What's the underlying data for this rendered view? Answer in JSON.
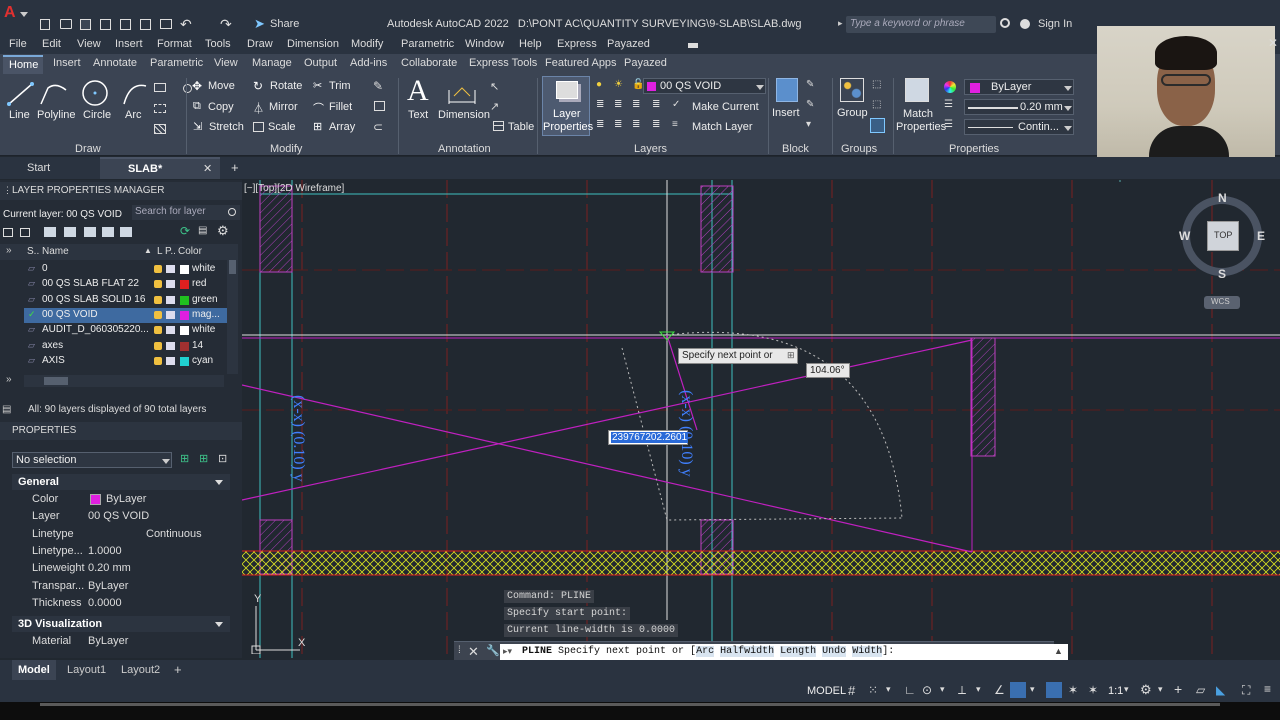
{
  "title": {
    "app": "Autodesk AutoCAD 2022",
    "path": "D:\\PONT AC\\QUANTITY SURVEYING\\9-SLAB\\SLAB.dwg",
    "share": "Share",
    "search_placeholder": "Type a keyword or phrase",
    "sign_in": "Sign In"
  },
  "menu": [
    "File",
    "Edit",
    "View",
    "Insert",
    "Format",
    "Tools",
    "Draw",
    "Dimension",
    "Modify",
    "Parametric",
    "Window",
    "Help",
    "Express",
    "Payazed"
  ],
  "ribbon_tabs": [
    "Home",
    "Insert",
    "Annotate",
    "Parametric",
    "View",
    "Manage",
    "Output",
    "Add-ins",
    "Collaborate",
    "Express Tools",
    "Featured Apps",
    "Payazed"
  ],
  "ribbon": {
    "draw": {
      "line": "Line",
      "polyline": "Polyline",
      "circle": "Circle",
      "arc": "Arc",
      "panel": "Draw"
    },
    "modify": {
      "move": "Move",
      "rotate": "Rotate",
      "trim": "Trim",
      "copy": "Copy",
      "mirror": "Mirror",
      "fillet": "Fillet",
      "stretch": "Stretch",
      "scale": "Scale",
      "array": "Array",
      "panel": "Modify"
    },
    "annotation": {
      "text": "Text",
      "dimension": "Dimension",
      "table": "Table",
      "panel": "Annotation"
    },
    "layers": {
      "layer_properties": "Layer Properties",
      "current": "00 QS VOID",
      "make_current": "Make Current",
      "match_layer": "Match Layer",
      "panel": "Layers"
    },
    "block": {
      "insert": "Insert",
      "panel": "Block"
    },
    "groups": {
      "group": "Group",
      "panel": "Groups"
    },
    "properties": {
      "match_properties": "Match Properties",
      "color": "ByLayer",
      "lineweight": "0.20 mm",
      "linetype": "Contin...",
      "panel": "Properties"
    }
  },
  "doc_tabs": {
    "start": "Start",
    "active": "SLAB*"
  },
  "layer_manager": {
    "title": "LAYER PROPERTIES MANAGER",
    "current_layer": "Current layer: 00 QS VOID",
    "search_placeholder": "Search for layer",
    "columns": [
      "S..",
      "Name",
      "L",
      "P..",
      "Color"
    ],
    "rows": [
      {
        "name": "0",
        "color": "white",
        "hex": "#ffffff"
      },
      {
        "name": "00 QS SLAB FLAT 22",
        "color": "red",
        "hex": "#e02020"
      },
      {
        "name": "00 QS SLAB SOLID 16",
        "color": "green",
        "hex": "#20c020"
      },
      {
        "name": "00 QS VOID",
        "color": "mag...",
        "hex": "#e020e0"
      },
      {
        "name": "AUDIT_D_060305220...",
        "color": "white",
        "hex": "#ffffff"
      },
      {
        "name": "axes",
        "color": "14",
        "hex": "#a03030"
      },
      {
        "name": "AXIS",
        "color": "cyan",
        "hex": "#20d0d0"
      }
    ],
    "footer": "All: 90 layers displayed of 90 total layers"
  },
  "properties": {
    "title": "PROPERTIES",
    "selection": "No selection",
    "general": "General",
    "rows": [
      {
        "label": "Color",
        "value": "ByLayer"
      },
      {
        "label": "Layer",
        "value": "00 QS VOID"
      },
      {
        "label": "Linetype",
        "value": "Continuous"
      },
      {
        "label": "Linetype...",
        "value": "1.0000"
      },
      {
        "label": "Lineweight",
        "value": "0.20 mm"
      },
      {
        "label": "Transpar...",
        "value": "ByLayer"
      },
      {
        "label": "Thickness",
        "value": "0.0000"
      }
    ],
    "visualization": "3D Visualization",
    "material_label": "Material",
    "material_value": "ByLayer"
  },
  "viewport": {
    "label": "[−][Top][2D Wireframe]",
    "tooltip": "Specify next point or",
    "angle": "104.06°",
    "length_input": "239767202.2601",
    "viewcube": {
      "top": "TOP",
      "n": "N",
      "s": "S",
      "e": "E",
      "w": "W",
      "wcs": "WCS"
    },
    "ucs_x": "X",
    "ucs_y": "Y"
  },
  "command": {
    "history": [
      "Command:  PLINE",
      "Specify start point:",
      "Current line-width is 0.0000"
    ],
    "prompt_cmd": "PLINE",
    "prompt_text": "Specify next point or [",
    "options": [
      "Arc",
      "Halfwidth",
      "Length",
      "Undo",
      "Width"
    ],
    "prompt_end": "]:"
  },
  "layout_tabs": [
    "Model",
    "Layout1",
    "Layout2"
  ],
  "status": {
    "model": "MODEL",
    "scale": "1:1"
  }
}
